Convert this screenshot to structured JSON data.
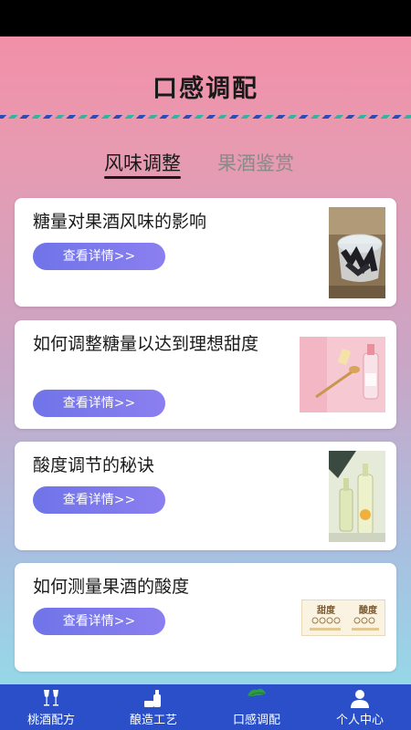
{
  "header": {
    "title": "口感调配"
  },
  "tabs": [
    {
      "label": "风味调整",
      "active": true
    },
    {
      "label": "果酒鉴赏",
      "active": false
    }
  ],
  "cards": [
    {
      "title": "糖量对果酒风味的影响",
      "button": "查看详情>>",
      "image": "wine-glass-ice-photo"
    },
    {
      "title": "如何调整糖量以达到理想甜度",
      "button": "查看详情>>",
      "image": "pink-bottle-photo"
    },
    {
      "title": "酸度调节的秘诀",
      "button": "查看详情>>",
      "image": "wine-bottles-photo"
    },
    {
      "title": "如何测量果酒的酸度",
      "button": "查看详情>>",
      "image": "sweetness-acidity-chart",
      "image_text": [
        "甜度",
        "酸度"
      ]
    }
  ],
  "bottom_nav": [
    {
      "label": "桃酒配方",
      "icon": "wine-glasses-icon",
      "active": false
    },
    {
      "label": "酿造工艺",
      "icon": "brewing-bottle-icon",
      "active": false
    },
    {
      "label": "口感调配",
      "icon": "leaf-icon",
      "active": true
    },
    {
      "label": "个人中心",
      "icon": "user-icon",
      "active": false
    }
  ],
  "colors": {
    "nav_bg": "#2a4fc8",
    "button_start": "#6f74e8",
    "button_end": "#8b7ff0",
    "leaf_green": "#2e9a4a"
  }
}
